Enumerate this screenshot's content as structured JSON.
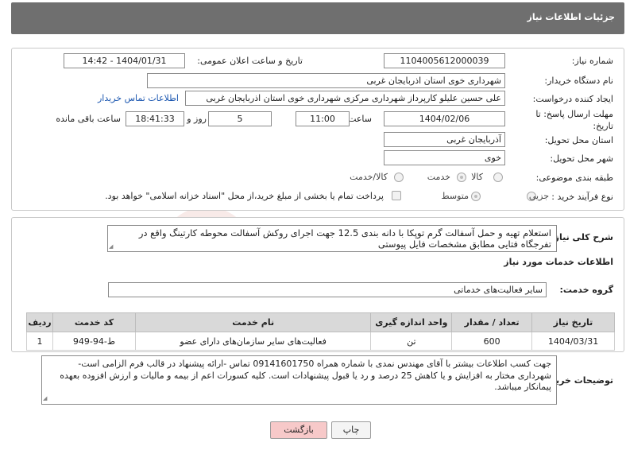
{
  "header": {
    "title": "جزئیات اطلاعات نیاز"
  },
  "form": {
    "need_number_label": "شماره نیاز:",
    "need_number": "1104005612000039",
    "announce_label": "تاریخ و ساعت اعلان عمومی:",
    "announce_value": "1404/01/31 - 14:42",
    "buyer_org_label": "نام دستگاه خریدار:",
    "buyer_org": "شهرداری خوی استان اذربایجان غربی",
    "creator_label": "ایجاد کننده درخواست:",
    "creator": "علی حسین علیلو کارپرداز شهرداری مرکزی شهرداری خوی استان اذربایجان غربی",
    "contact_link": "اطلاعات تماس خریدار",
    "deadline_label_1": "مهلت ارسال پاسخ: تا",
    "deadline_label_2": "تاریخ:",
    "deadline_date": "1404/02/06",
    "time_label": "ساعت",
    "deadline_time": "11:00",
    "days_value": "5",
    "days_label": "روز و",
    "remaining_time": "18:41:33",
    "remaining_label": "ساعت باقی مانده",
    "province_label": "استان محل تحویل:",
    "province": "آذربایجان غربی",
    "city_label": "شهر محل تحویل:",
    "city": "خوی",
    "category_label": "طبقه بندی موضوعی:",
    "category_options": [
      "کالا",
      "خدمت",
      "کالا/خدمت"
    ],
    "category_selected": "خدمت",
    "process_label": "نوع فرآیند خرید :",
    "process_options": [
      "جزیی",
      "متوسط"
    ],
    "process_selected": "متوسط",
    "payment_note": "پرداخت تمام یا بخشی از مبلغ خرید،از محل \"اسناد خزانه اسلامی\" خواهد بود."
  },
  "description": {
    "label": "شرح کلی نیاز:",
    "text": "استعلام تهیه و حمل آسفالت گرم توپکا با دانه بندی 12.5 جهت اجرای روکش آسفالت محوطه کارتینگ واقع در تفرجگاه فتایی مطابق مشخصات فایل پیوستی"
  },
  "services": {
    "section_title": "اطلاعات خدمات مورد نیاز",
    "group_label": "گروه خدمت:",
    "group_value": "سایر فعالیت‌های خدماتی",
    "columns": [
      "ردیف",
      "کد خدمت",
      "نام خدمت",
      "واحد اندازه گیری",
      "تعداد / مقدار",
      "تاریخ نیاز"
    ],
    "rows": [
      [
        "1",
        "ط-94-949",
        "فعالیت‌های سایر سازمان‌های دارای عضو",
        "تن",
        "600",
        "1404/03/31"
      ]
    ]
  },
  "buyer_notes": {
    "label": "توضیحات خریدار:",
    "text": "جهت کسب اطلاعات بیشتر با آقای مهندس نمدی با شماره همراه 09141601750 تماس -ارائه پیشنهاد در قالب فرم الزامی است-شهرداری مختار به افزایش و یا کاهش 25 درصد و رد یا قبول پیشنهادات است. کلیه کسورات اعم از بیمه و مالیات و ارزش افزوده بعهده پیمانکار میباشد."
  },
  "buttons": {
    "print": "چاپ",
    "back": "بازگشت"
  },
  "watermark": {
    "text": "AriaTender.neT"
  },
  "colors": {
    "header_bg": "#6f6f6f",
    "back_btn_bg": "#f7c9c9",
    "link": "#1a56b0",
    "watermark": "#c0392b"
  }
}
